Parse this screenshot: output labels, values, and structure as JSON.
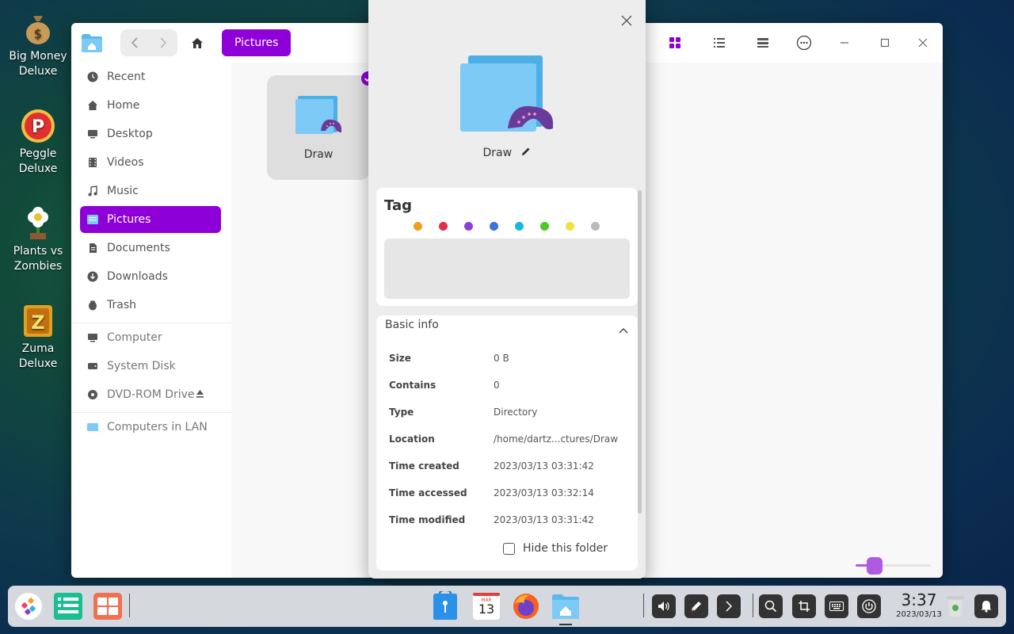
{
  "desktop": {
    "icons": [
      {
        "label": "Big Money Deluxe",
        "line1": "Big Money",
        "line2": "Deluxe"
      },
      {
        "label": "Peggle Deluxe",
        "line1": "Peggle",
        "line2": "Deluxe"
      },
      {
        "label": "Plants vs Zombies",
        "line1": "Plants vs",
        "line2": "Zombies"
      },
      {
        "label": "Zuma Deluxe",
        "line1": "Zuma",
        "line2": "Deluxe"
      }
    ]
  },
  "file_manager": {
    "breadcrumb": "Pictures",
    "sidebar": {
      "items": [
        {
          "label": "Recent",
          "icon": "clock-icon"
        },
        {
          "label": "Home",
          "icon": "home-icon"
        },
        {
          "label": "Desktop",
          "icon": "desktop-icon"
        },
        {
          "label": "Videos",
          "icon": "film-icon"
        },
        {
          "label": "Music",
          "icon": "music-note-icon"
        },
        {
          "label": "Pictures",
          "icon": "pictures-icon",
          "active": true
        },
        {
          "label": "Documents",
          "icon": "document-icon"
        },
        {
          "label": "Downloads",
          "icon": "download-icon"
        },
        {
          "label": "Trash",
          "icon": "trash-icon"
        },
        {
          "label": "Computer",
          "icon": "computer-icon"
        },
        {
          "label": "System Disk",
          "icon": "disk-icon"
        },
        {
          "label": "DVD-ROM Drive",
          "icon": "dvd-icon"
        },
        {
          "label": "Computers in LAN",
          "icon": "network-icon"
        }
      ]
    },
    "files": [
      {
        "name": "Draw",
        "selected": true
      }
    ]
  },
  "properties": {
    "name": "Draw",
    "tag_title": "Tag",
    "tag_colors": [
      "#f0a020",
      "#e0304a",
      "#8a40d8",
      "#3a70e0",
      "#18b8e0",
      "#50c828",
      "#f0e040",
      "#bbbbbb"
    ],
    "basic_info_title": "Basic info",
    "rows": [
      {
        "key": "Size",
        "value": "0 B"
      },
      {
        "key": "Contains",
        "value": "0"
      },
      {
        "key": "Type",
        "value": "Directory"
      },
      {
        "key": "Location",
        "value": "/home/dartz...ctures/Draw"
      },
      {
        "key": "Time created",
        "value": "2023/03/13 03:31:42"
      },
      {
        "key": "Time accessed",
        "value": "2023/03/13 03:32:14"
      },
      {
        "key": "Time modified",
        "value": "2023/03/13 03:31:42"
      }
    ],
    "hide_label": "Hide this folder"
  },
  "taskbar": {
    "time": "3:37",
    "date": "2023/03/13",
    "calendar_day": "13",
    "calendar_month": "MAR"
  },
  "colors": {
    "accent": "#8d00d8"
  }
}
